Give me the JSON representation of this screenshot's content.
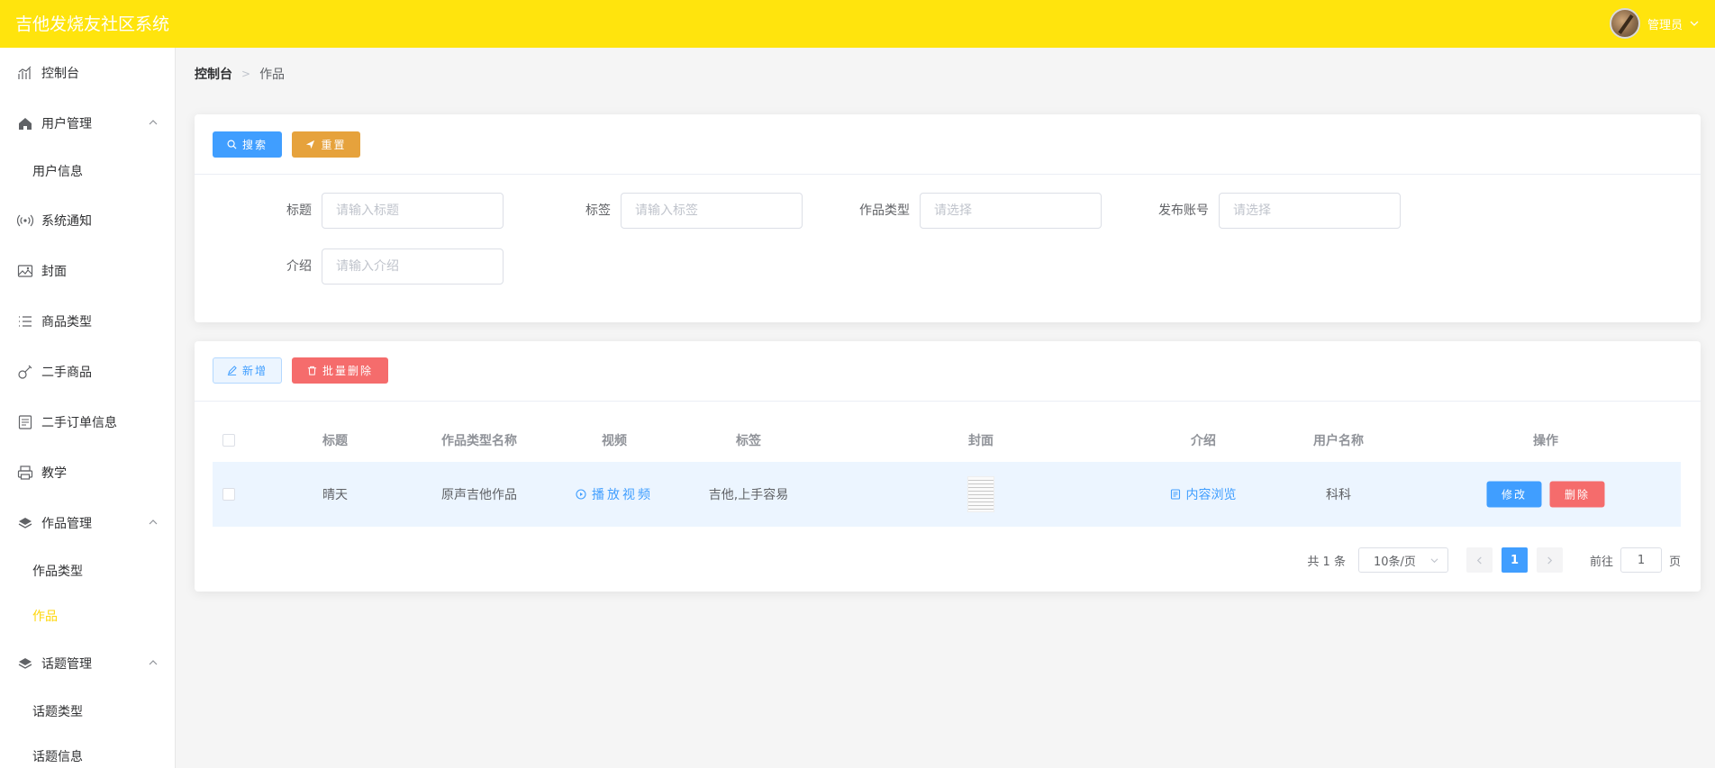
{
  "header": {
    "title": "吉他发烧友社区系统",
    "user_name": "管理员"
  },
  "sidebar": {
    "items": [
      {
        "label": "控制台",
        "icon": "chart-icon"
      },
      {
        "label": "用户管理",
        "icon": "home-icon",
        "expanded": true
      },
      {
        "label": "用户信息"
      },
      {
        "label": "系统通知",
        "icon": "broadcast-icon"
      },
      {
        "label": "封面",
        "icon": "image-icon"
      },
      {
        "label": "商品类型",
        "icon": "list-icon"
      },
      {
        "label": "二手商品",
        "icon": "guitar-icon"
      },
      {
        "label": "二手订单信息",
        "icon": "order-icon"
      },
      {
        "label": "教学",
        "icon": "printer-icon"
      },
      {
        "label": "作品管理",
        "icon": "layers-icon",
        "expanded": true
      },
      {
        "label": "作品类型"
      },
      {
        "label": "作品",
        "active": true
      },
      {
        "label": "话题管理",
        "icon": "layers-icon",
        "expanded": true
      },
      {
        "label": "话题类型"
      },
      {
        "label": "话题信息"
      }
    ],
    "active_color": "#ffd60a"
  },
  "breadcrumb": {
    "home": "控制台",
    "current": "作品"
  },
  "search": {
    "search_btn": "搜索",
    "reset_btn": "重置",
    "fields": {
      "title_label": "标题",
      "title_placeholder": "请输入标题",
      "tag_label": "标签",
      "tag_placeholder": "请输入标签",
      "type_label": "作品类型",
      "type_placeholder": "请选择",
      "account_label": "发布账号",
      "account_placeholder": "请选择",
      "intro_label": "介绍",
      "intro_placeholder": "请输入介绍"
    }
  },
  "toolbar": {
    "add_btn": "新增",
    "batch_delete_btn": "批量删除"
  },
  "table": {
    "columns": [
      "标题",
      "作品类型名称",
      "视频",
      "标签",
      "封面",
      "介绍",
      "用户名称",
      "操作"
    ],
    "rows": [
      {
        "title": "晴天",
        "type_name": "原声吉他作品",
        "video": "播放视频",
        "tags": "吉他,上手容易",
        "intro": "内容浏览",
        "user_name": "科科",
        "edit": "修改",
        "delete": "删除"
      }
    ]
  },
  "pagination": {
    "total": "共 1 条",
    "page_size": "10条/页",
    "current_page": "1",
    "goto_prefix": "前往",
    "goto_value": "1",
    "goto_suffix": "页"
  },
  "colors": {
    "header": "#ffe40d",
    "primary": "#409eff",
    "warning": "#e6a23c",
    "danger": "#f56c6c"
  }
}
